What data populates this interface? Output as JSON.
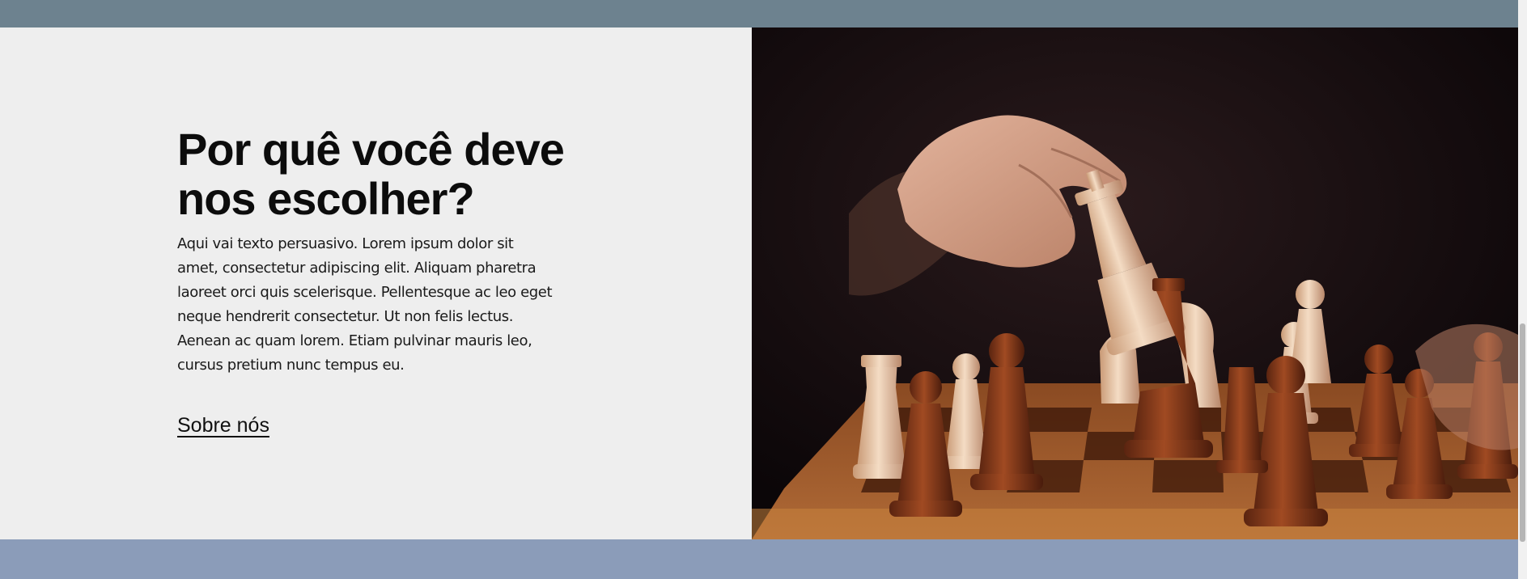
{
  "colors": {
    "top_band": "#6d828f",
    "bottom_band": "#8b9cb9",
    "section_background": "#eeeeee",
    "heading": "#0c0c0c",
    "body_text": "#1a1a1a"
  },
  "section": {
    "heading": "Por quê você deve nos escolher?",
    "body": "Aqui vai texto persuasivo. Lorem ipsum dolor sit amet, consectetur adipiscing elit. Aliquam pharetra laoreet orci quis scelerisque. Pellentesque ac leo eget neque hendrerit consectetur. Ut non felis lectus. Aenean ac quam lorem. Etiam pulvinar mauris leo, cursus pretium nunc tempus eu.",
    "link_label": "Sobre nós"
  },
  "image": {
    "subject": "hand moving a white chess king on a wooden chessboard"
  }
}
